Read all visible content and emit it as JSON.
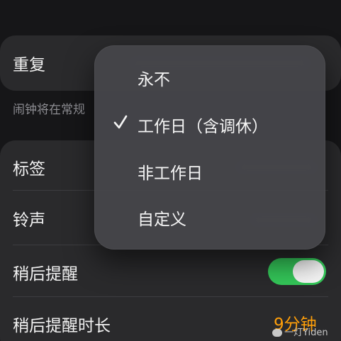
{
  "repeat": {
    "label": "重复"
  },
  "hint": {
    "text": "闹钟将在常规"
  },
  "rows": {
    "label_tag": "标签",
    "ringtone": "铃声",
    "snooze": "稍后提醒",
    "snooze_duration": "稍后提醒时长",
    "snooze_duration_value": "9分钟"
  },
  "snooze_toggle": {
    "on": true
  },
  "menu": {
    "items": [
      {
        "label": "永不",
        "selected": false
      },
      {
        "label": "工作日（含调休）",
        "selected": true
      },
      {
        "label": "非工作日",
        "selected": false
      },
      {
        "label": "自定义",
        "selected": false
      }
    ]
  },
  "watermark": {
    "text": "一灯Yiden"
  },
  "colors": {
    "accent_orange": "#ff9f0a",
    "toggle_green": "#34c759",
    "background": "#161618",
    "card": "#2a2a2c",
    "menu": "#46464a"
  }
}
